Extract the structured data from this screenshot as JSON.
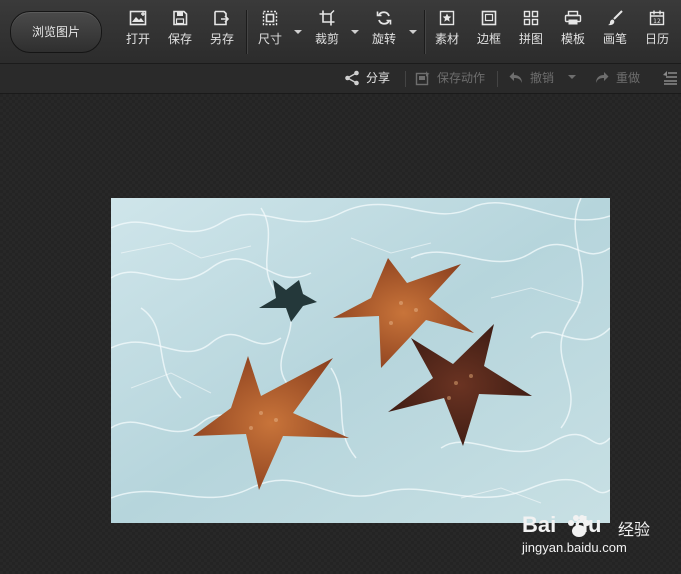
{
  "toolbar": {
    "browse_label": "浏览图片",
    "tools": [
      {
        "id": "open",
        "label": "打开",
        "icon": "open-image-icon"
      },
      {
        "id": "save",
        "label": "保存",
        "icon": "save-icon"
      },
      {
        "id": "save_as",
        "label": "另存",
        "icon": "save-as-icon"
      },
      {
        "id": "size",
        "label": "尺寸",
        "icon": "resize-icon"
      },
      {
        "id": "crop",
        "label": "裁剪",
        "icon": "crop-icon"
      },
      {
        "id": "rotate",
        "label": "旋转",
        "icon": "rotate-icon"
      },
      {
        "id": "material",
        "label": "素材",
        "icon": "star-material-icon"
      },
      {
        "id": "border",
        "label": "边框",
        "icon": "border-frame-icon"
      },
      {
        "id": "collage",
        "label": "拼图",
        "icon": "collage-grid-icon"
      },
      {
        "id": "template",
        "label": "模板",
        "icon": "template-printer-icon"
      },
      {
        "id": "brush",
        "label": "画笔",
        "icon": "brush-icon"
      },
      {
        "id": "calendar",
        "label": "日历",
        "icon": "calendar-icon"
      }
    ]
  },
  "subbar": {
    "share_label": "分享",
    "save_action_label": "保存动作",
    "undo_label": "撤销",
    "redo_label": "重做"
  },
  "watermark": {
    "logo": "Bai   du",
    "name": "经验",
    "url": "jingyan.baidu.com"
  },
  "colors": {
    "toolbar_bg": "#333333",
    "canvas_bg": "#242424",
    "water": "#b9d8df",
    "starfish_orange": "#b45f2b",
    "starfish_dark": "#4a2419",
    "starfish_small": "#24383a"
  }
}
